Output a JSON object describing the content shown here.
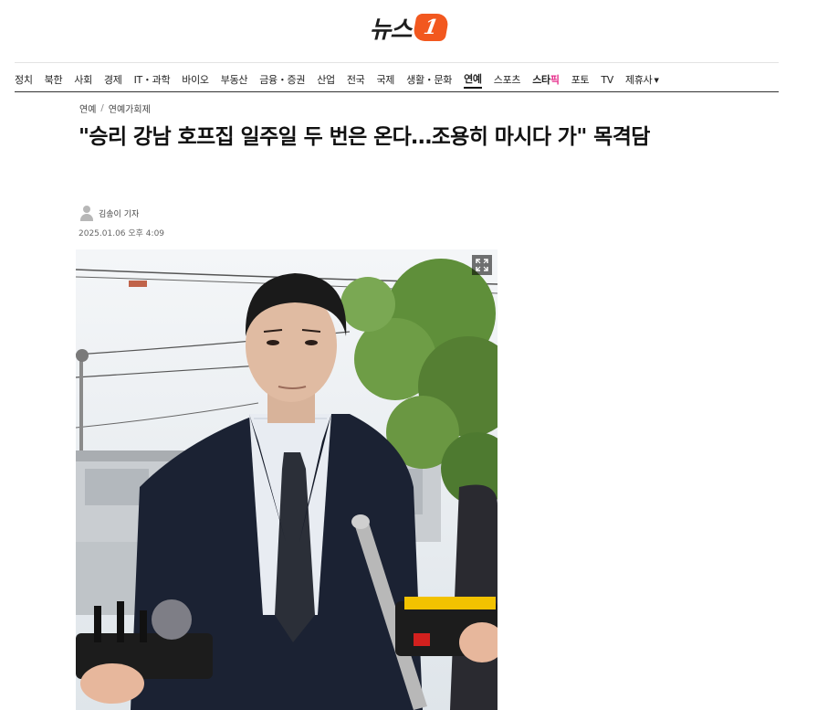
{
  "site": {
    "logo_text": "뉴스",
    "logo_badge": "1",
    "brand_color": "#f2581f"
  },
  "nav": {
    "items": [
      {
        "label": "정치",
        "active": false
      },
      {
        "label": "북한",
        "active": false
      },
      {
        "label": "사회",
        "active": false
      },
      {
        "label": "경제",
        "active": false
      },
      {
        "label": "IT・과학",
        "active": false
      },
      {
        "label": "바이오",
        "active": false
      },
      {
        "label": "부동산",
        "active": false
      },
      {
        "label": "금융・증권",
        "active": false
      },
      {
        "label": "산업",
        "active": false
      },
      {
        "label": "전국",
        "active": false
      },
      {
        "label": "국제",
        "active": false
      },
      {
        "label": "생활・문화",
        "active": false
      },
      {
        "label": "연예",
        "active": true
      },
      {
        "label": "스포츠",
        "active": false
      }
    ],
    "star_black": "스타",
    "star_pink": "픽",
    "photo_label": "포토",
    "tv_label": "TV",
    "partner_label": "제휴사",
    "caret": "▼"
  },
  "breadcrumb": {
    "section": "연예",
    "separator": "/",
    "subsection": "연예가회제"
  },
  "article": {
    "headline": "\"승리 강남 호프집 일주일 두 번은 온다…조용히 마시다 가\" 목격담",
    "author": "김송이 기자",
    "date": "2025.01.06 오후 4:09",
    "photo_alt": "승리 photo",
    "expand_icon": "expand-icon"
  }
}
